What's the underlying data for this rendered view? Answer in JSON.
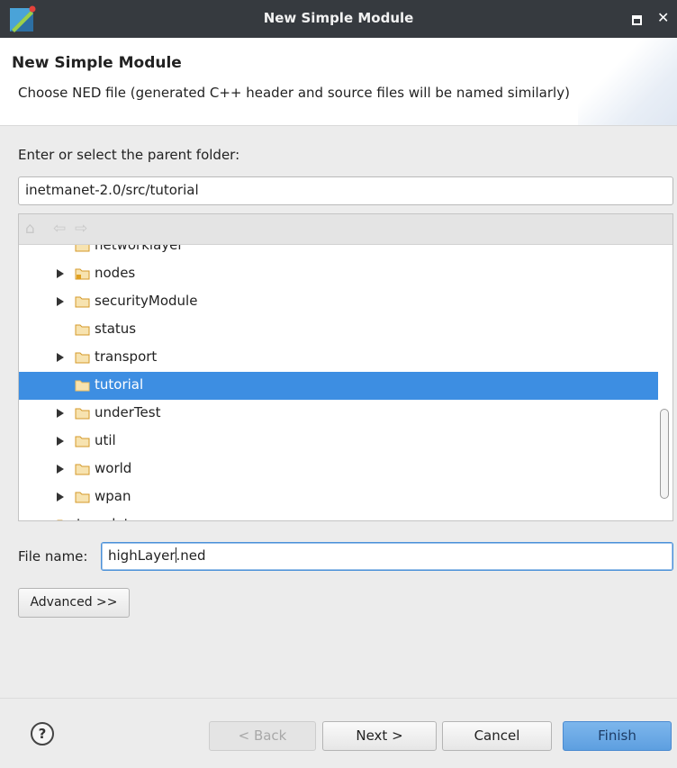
{
  "window": {
    "title": "New Simple Module"
  },
  "banner": {
    "title": "New Simple Module",
    "description": "Choose NED file (generated C++ header and source files will be named similarly)"
  },
  "parent_folder": {
    "label": "Enter or select the parent folder:",
    "value": "inetmanet-2.0/src/tutorial"
  },
  "tree": {
    "toolbar": [
      "home-icon",
      "back-icon",
      "forward-icon"
    ],
    "items": [
      {
        "label": "networklayer",
        "has_children": true,
        "selected": false
      },
      {
        "label": "nodes",
        "has_children": true,
        "selected": false
      },
      {
        "label": "securityModule",
        "has_children": true,
        "selected": false
      },
      {
        "label": "status",
        "has_children": false,
        "selected": false
      },
      {
        "label": "transport",
        "has_children": true,
        "selected": false
      },
      {
        "label": "tutorial",
        "has_children": false,
        "selected": true
      },
      {
        "label": "underTest",
        "has_children": true,
        "selected": false
      },
      {
        "label": "util",
        "has_children": true,
        "selected": false
      },
      {
        "label": "world",
        "has_children": true,
        "selected": false
      },
      {
        "label": "wpan",
        "has_children": true,
        "selected": false
      },
      {
        "label": "templates",
        "has_children": true,
        "selected": false
      }
    ]
  },
  "file_name": {
    "label": "File name:",
    "value_before_caret": "highLayer",
    "value_after_caret": ".ned"
  },
  "buttons": {
    "advanced": "Advanced >>",
    "help": "?",
    "back": "< Back",
    "next": "Next >",
    "cancel": "Cancel",
    "finish": "Finish"
  },
  "colors": {
    "selection": "#3d8ee2",
    "titlebar": "#363a3f",
    "folder": "#e8a93a"
  }
}
